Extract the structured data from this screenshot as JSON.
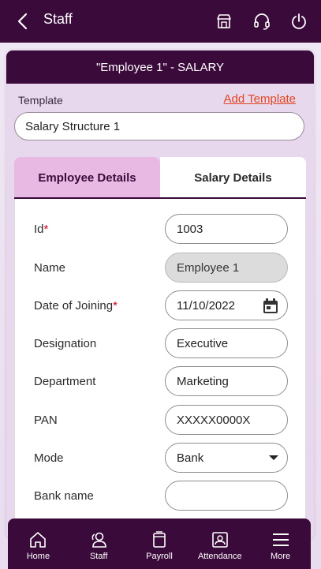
{
  "header": {
    "title": "Staff"
  },
  "card": {
    "title": "\"Employee 1\" - SALARY",
    "template_label": "Template",
    "add_template": "Add Template",
    "template_value": "Salary Structure 1"
  },
  "tabs": [
    {
      "label": "Employee Details",
      "active": true
    },
    {
      "label": "Salary Details",
      "active": false
    }
  ],
  "form": {
    "id": {
      "label": "Id",
      "value": "1003",
      "required": true
    },
    "name": {
      "label": "Name",
      "value": "Employee 1"
    },
    "doj": {
      "label": "Date of Joining",
      "value": "11/10/2022",
      "required": true
    },
    "designation": {
      "label": "Designation",
      "value": "Executive"
    },
    "department": {
      "label": "Department",
      "value": "Marketing"
    },
    "pan": {
      "label": "PAN",
      "value": "XXXXX0000X"
    },
    "mode": {
      "label": "Mode",
      "value": "Bank"
    },
    "bank_name": {
      "label": "Bank name",
      "value": ""
    }
  },
  "nav": [
    {
      "label": "Home",
      "icon": "home-icon"
    },
    {
      "label": "Staff",
      "icon": "staff-icon"
    },
    {
      "label": "Payroll",
      "icon": "payroll-icon"
    },
    {
      "label": "Attendance",
      "icon": "attendance-icon"
    },
    {
      "label": "More",
      "icon": "menu-icon"
    }
  ],
  "colors": {
    "primary": "#3a0a3a",
    "accent_link": "#e2451f",
    "tab_active": "#e7b9e3"
  }
}
